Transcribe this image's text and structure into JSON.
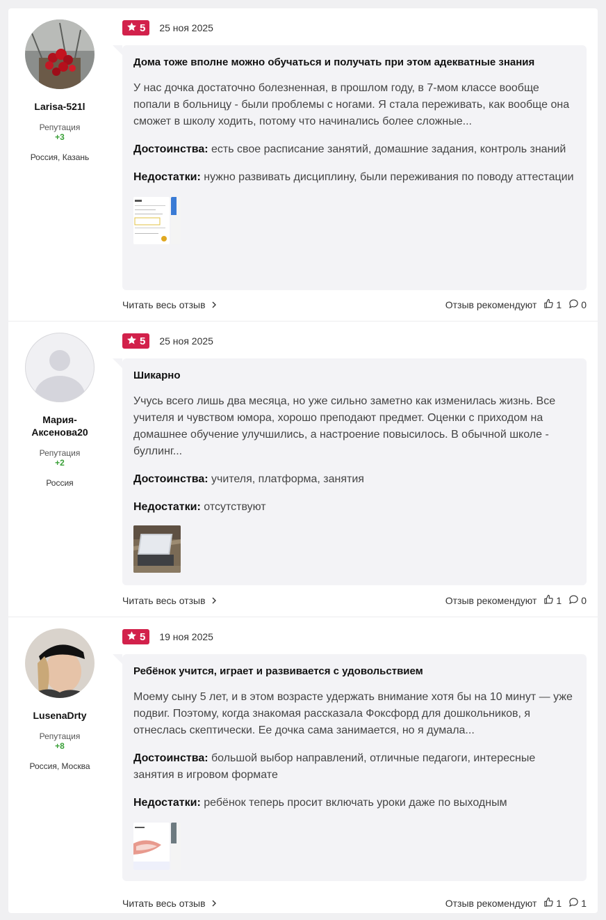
{
  "common": {
    "reputation_label": "Репутация",
    "read_more": "Читать весь отзыв",
    "recommend_label": "Отзыв рекомендуют",
    "pros_label": "Достоинства:",
    "cons_label": "Недостатки:",
    "accent_color": "#d2214b",
    "positive_color": "#3aa038"
  },
  "reviews": [
    {
      "author": "Larisa-521l",
      "reputation": "+3",
      "location": "Россия, Казань",
      "rating": "5",
      "date": "25 ноя 2025",
      "title": "Дома тоже вполне можно обучаться и получать при этом адекватные знания",
      "text": "У нас дочка достаточно болезненная, в прошлом году, в 7-мом классе вообще попали в больницу - были проблемы с ногами. Я стала переживать, как вообще она сможет в школу ходить, потому что начинались более сложные...",
      "pros": "есть свое расписание занятий, домашние задания, контроль знаний",
      "cons": "нужно развивать дисциплину, были переживания по поводу аттестации",
      "likes": "1",
      "comments": "0"
    },
    {
      "author": "Мария-Аксенова20",
      "reputation": "+2",
      "location": "Россия",
      "rating": "5",
      "date": "25 ноя 2025",
      "title": "Шикарно",
      "text": "Учусь всего лишь два месяца, но уже сильно заметно как изменилась жизнь. Все учителя и чувством юмора, хорошо преподают предмет. Оценки с приходом на домашнее обучение улучшились, а настроение повысилось. В обычной школе - буллинг...",
      "pros": "учителя, платформа, занятия",
      "cons": "отсутствуют",
      "likes": "1",
      "comments": "0"
    },
    {
      "author": "LusenaDrty",
      "reputation": "+8",
      "location": "Россия, Москва",
      "rating": "5",
      "date": "19 ноя 2025",
      "title": "Ребёнок учится, играет и развивается с удовольствием",
      "text": "Моему сыну 5 лет, и в этом возрасте удержать внимание хотя бы на 10 минут — уже подвиг. Поэтому, когда знакомая рассказала Фоксфорд для дошкольников, я отнеслась скептически. Ее дочка сама занимается, но я думала...",
      "pros": "большой выбор направлений, отличные педагоги, интересные занятия в игровом формате",
      "cons": "ребёнок теперь просит включать уроки даже по выходным",
      "likes": "1",
      "comments": "1"
    }
  ]
}
